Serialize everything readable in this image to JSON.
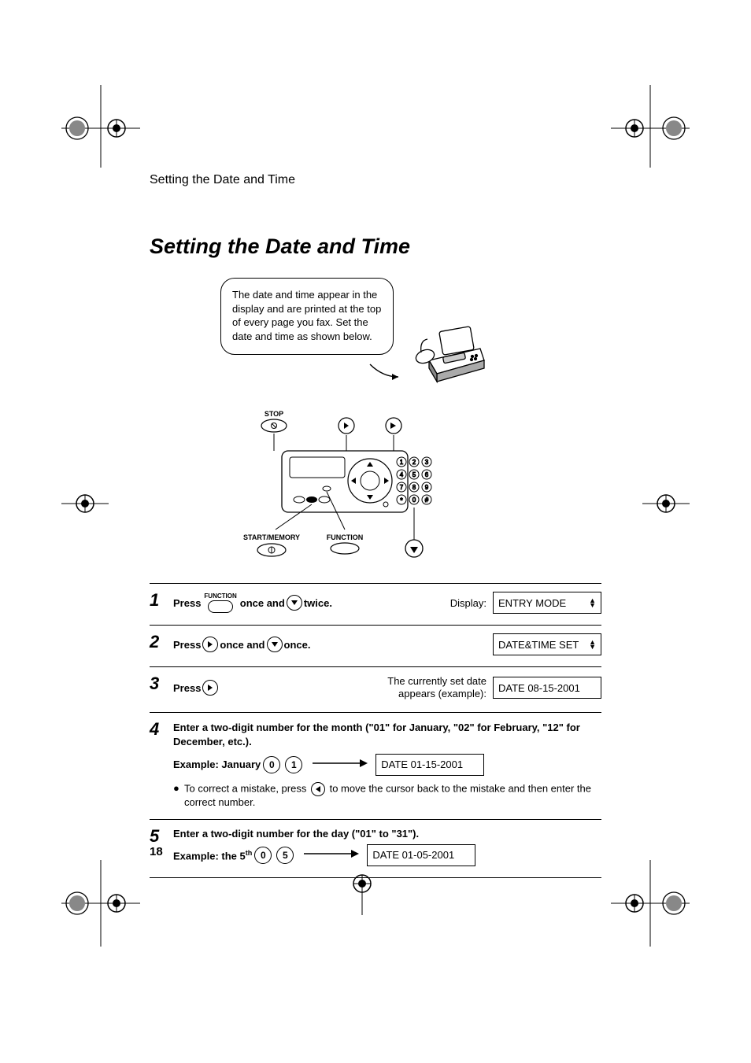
{
  "running_head": "Setting the Date and Time",
  "title": "Setting the Date and Time",
  "bubble_text": "The date and time appear in the display and are printed at the top of every page you fax. Set the date and time as shown below.",
  "diagram": {
    "stop_label": "STOP",
    "start_memory_label": "START/MEMORY",
    "function_label": "FUNCTION"
  },
  "keys": {
    "function": "FUNCTION",
    "start_memory": "START/MEMORY",
    "stop": "STOP"
  },
  "steps": [
    {
      "num": "1",
      "press": "Press",
      "once_and": "once and",
      "twice": "twice.",
      "display_word": "Display:",
      "lcd": "ENTRY MODE"
    },
    {
      "num": "2",
      "press": "Press",
      "once_and": "once and",
      "once": "once.",
      "lcd": "DATE&TIME SET"
    },
    {
      "num": "3",
      "press": "Press",
      "note_line1": "The currently set date",
      "note_line2": "appears (example):",
      "lcd": "DATE 08-15-2001"
    },
    {
      "num": "4",
      "text": "Enter a two-digit number for the month (\"01\" for January, \"02\" for February, \"12\" for December, etc.).",
      "example_label": "Example: January",
      "key_a": "0",
      "key_b": "1",
      "lcd": "DATE 01-15-2001",
      "bullet_a": "To correct a mistake, press",
      "bullet_b": "to move the cursor back to the mistake and then enter the correct number."
    },
    {
      "num": "5",
      "text": "Enter a two-digit number for the day (\"01\" to \"31\").",
      "example_label": "Example: the 5",
      "example_sup": "th",
      "key_a": "0",
      "key_b": "5",
      "lcd": "DATE 01-05-2001"
    }
  ],
  "page_number": "18"
}
